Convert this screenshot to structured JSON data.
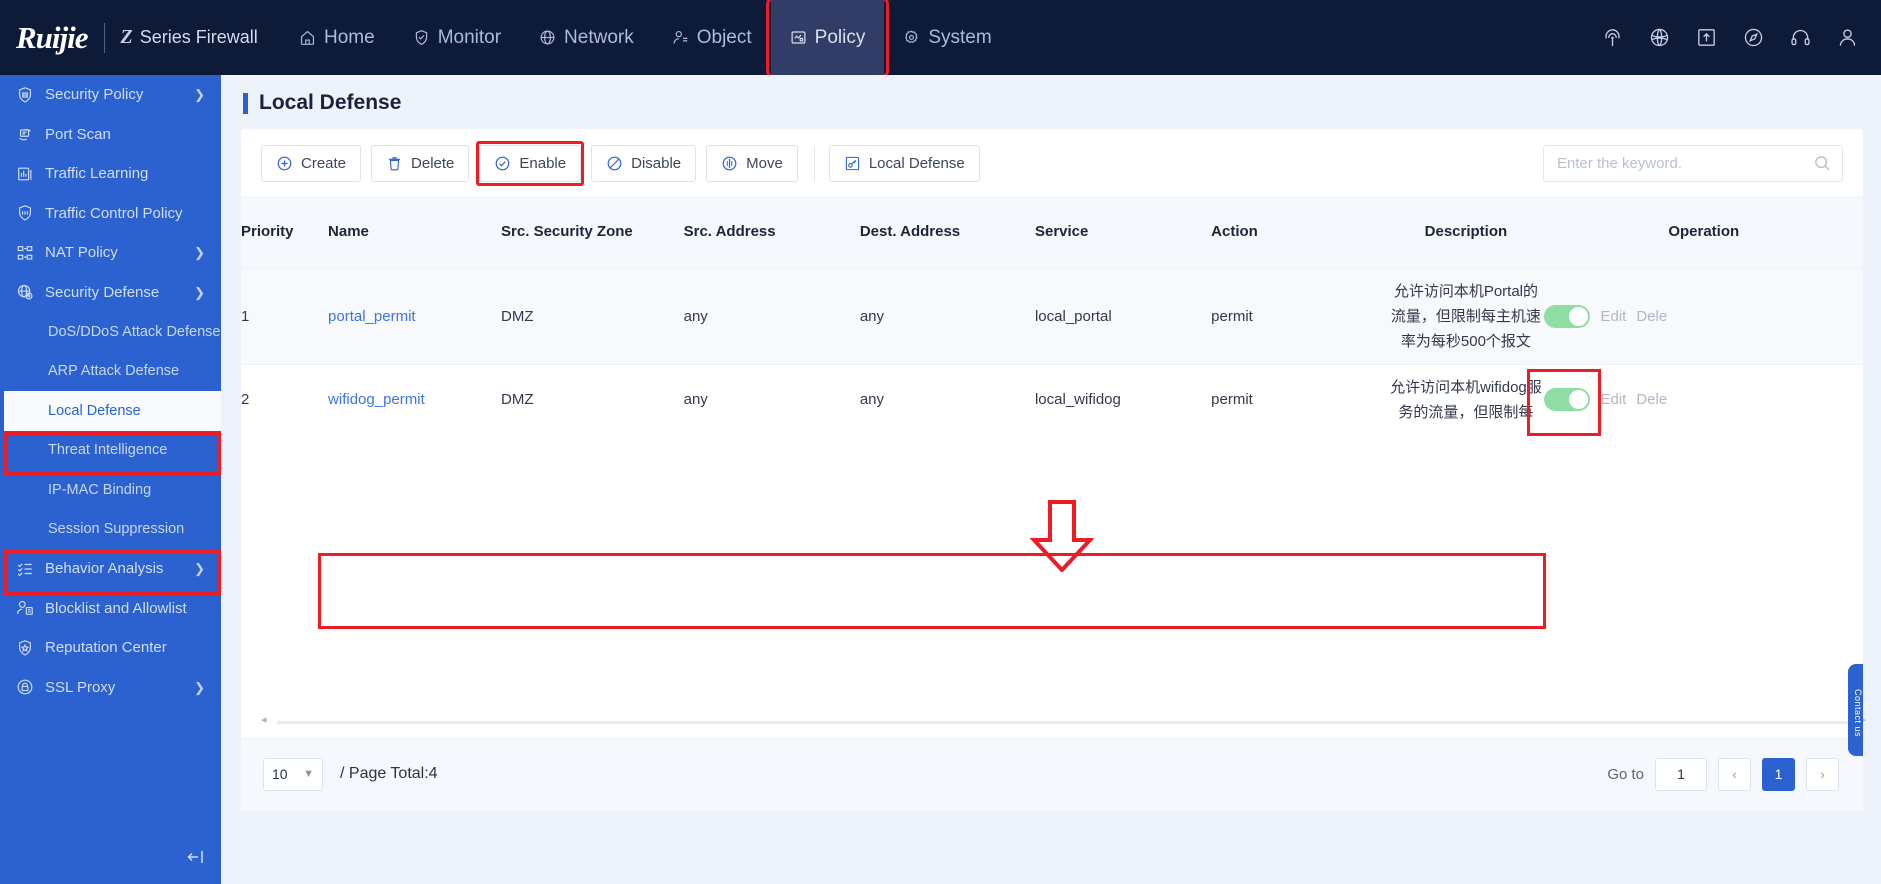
{
  "header": {
    "brand": "Ruijie",
    "series_mark": "Z",
    "series_text": "Series Firewall",
    "nav": [
      {
        "label": "Home",
        "icon": "home-icon",
        "active": false
      },
      {
        "label": "Monitor",
        "icon": "shield-check-icon",
        "active": false
      },
      {
        "label": "Network",
        "icon": "globe-icon",
        "active": false
      },
      {
        "label": "Object",
        "icon": "user-object-icon",
        "active": false
      },
      {
        "label": "Policy",
        "icon": "policy-icon",
        "active": true
      },
      {
        "label": "System",
        "icon": "gear-icon",
        "active": false
      }
    ],
    "icons": [
      "signal-icon",
      "globe-net-icon",
      "upload-icon",
      "compass-icon",
      "headset-icon",
      "user-icon"
    ]
  },
  "sidebar": {
    "items": [
      {
        "label": "Security Policy",
        "icon": "security-policy-icon",
        "chevron": "right"
      },
      {
        "label": "Port Scan",
        "icon": "port-scan-icon",
        "chevron": ""
      },
      {
        "label": "Traffic Learning",
        "icon": "bar-chart-icon",
        "chevron": ""
      },
      {
        "label": "Traffic Control Policy",
        "icon": "traffic-control-icon",
        "chevron": ""
      },
      {
        "label": "NAT Policy",
        "icon": "nat-icon",
        "chevron": "right"
      },
      {
        "label": "Security Defense",
        "icon": "security-defense-icon",
        "chevron": "down",
        "highlighted": true
      }
    ],
    "sub_items": [
      {
        "label": "DoS/DDoS Attack Defense",
        "selected": false
      },
      {
        "label": "ARP Attack Defense",
        "selected": false
      },
      {
        "label": "Local Defense",
        "selected": true,
        "highlighted": true
      },
      {
        "label": "Threat Intelligence",
        "selected": false
      },
      {
        "label": "IP-MAC Binding",
        "selected": false
      },
      {
        "label": "Session Suppression",
        "selected": false
      }
    ],
    "items_after": [
      {
        "label": "Behavior Analysis",
        "icon": "behavior-analysis-icon",
        "chevron": "right"
      },
      {
        "label": "Blocklist and Allowlist",
        "icon": "blocklist-icon",
        "chevron": ""
      },
      {
        "label": "Reputation Center",
        "icon": "reputation-icon",
        "chevron": ""
      },
      {
        "label": "SSL Proxy",
        "icon": "ssl-proxy-icon",
        "chevron": "right"
      }
    ],
    "collapse_icon": "collapse-sidebar-icon"
  },
  "page": {
    "title": "Local Defense"
  },
  "toolbar": {
    "create": "Create",
    "delete": "Delete",
    "enable": "Enable",
    "disable": "Disable",
    "move": "Move",
    "local_defense": "Local Defense"
  },
  "search": {
    "placeholder": "Enter the keyword.",
    "value": ""
  },
  "table": {
    "columns": [
      "Priority",
      "Name",
      "Src. Security Zone",
      "Src. Address",
      "Dest. Address",
      "Service",
      "Action",
      "Description",
      "Operation"
    ],
    "rows": [
      {
        "priority": "1",
        "name": "portal_permit",
        "src_zone": "DMZ",
        "src_address": "any",
        "dest_address": "any",
        "service": "local_portal",
        "action": "permit",
        "description": "允许访问本机Portal的流量，但限制每主机速率为每秒500个报文",
        "enabled": true,
        "edit": "Edit",
        "delete": "Dele"
      },
      {
        "priority": "2",
        "name": "wifidog_permit",
        "src_zone": "DMZ",
        "src_address": "any",
        "dest_address": "any",
        "service": "local_wifidog",
        "action": "permit",
        "description": "允许访问本机wifidog服务的流量，但限制每",
        "enabled": true,
        "edit": "Edit",
        "delete": "Dele"
      }
    ]
  },
  "footer": {
    "page_size": "10",
    "page_total": "/ Page Total:4",
    "goto_label": "Go to",
    "goto_value": "1",
    "prev": "‹",
    "next": "›",
    "current_page": "1"
  },
  "side_tab": {
    "label": "Contact us"
  },
  "colors": {
    "brand_blue": "#2b62d0",
    "topbar_navy": "#0d1a38",
    "annotation_red": "#ee1c24",
    "toggle_green": "#8fdfa5",
    "link_blue": "#3c74e6"
  }
}
